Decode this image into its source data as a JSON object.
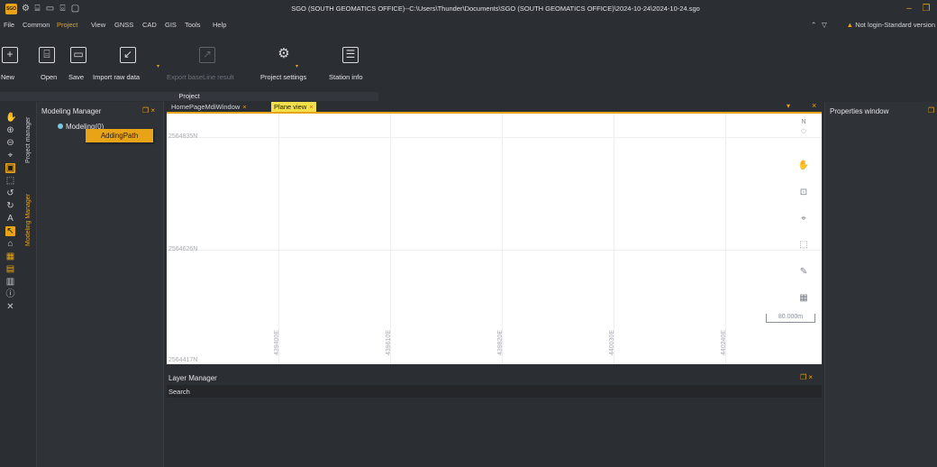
{
  "titlebar": {
    "logo": "SGO",
    "title": "SGO (SOUTH GEOMATICS OFFICE)--C:\\Users\\Thunder\\Documents\\SGO (SOUTH GEOMATICS OFFICE)\\2024-10-24\\2024-10-24.sgo",
    "quick_icons": [
      "settings-icon",
      "open-icon",
      "save-icon",
      "import-icon",
      "export-icon"
    ]
  },
  "menu": {
    "items": [
      "File",
      "Common",
      "Project",
      "View",
      "GNSS",
      "CAD",
      "GIS",
      "Tools",
      "Help"
    ],
    "active": "Project",
    "login": "Not login-Standard version"
  },
  "ribbon": {
    "buttons": [
      {
        "label": "New",
        "icon": "new-project-icon",
        "glyph": "+",
        "enabled": true
      },
      {
        "label": "Open",
        "icon": "open-folder-icon",
        "glyph": "⌸",
        "enabled": true
      },
      {
        "label": "Save",
        "icon": "save-icon",
        "glyph": "▭",
        "enabled": true
      },
      {
        "label": "Import raw data",
        "icon": "import-icon",
        "glyph": "↙",
        "enabled": true
      },
      {
        "label": "Export baseLine result",
        "icon": "export-icon",
        "glyph": "↗",
        "enabled": false
      },
      {
        "label": "Project settings",
        "icon": "gear-icon",
        "glyph": "⚙",
        "enabled": true
      },
      {
        "label": "Station info",
        "icon": "document-icon",
        "glyph": "☰",
        "enabled": true
      }
    ],
    "group_label": "Project"
  },
  "left_tabs": [
    "Project manager",
    "Modeling Manager"
  ],
  "modeling": {
    "title": "Modeling Manager",
    "tree_node": "Modeling(0)",
    "context_menu_item": "AddingPath"
  },
  "tabs": [
    "HomePageMdiWindow",
    "Plane view"
  ],
  "active_tab": "Plane view",
  "plane_view": {
    "northing_labels": [
      "2564835N",
      "2564626N",
      "2564417N"
    ],
    "easting_labels": [
      "439400E",
      "439610E",
      "439820E",
      "440030E",
      "440240E"
    ],
    "scale": "80.000m",
    "tools": [
      "pan-hand-icon",
      "zoom-window-icon",
      "zoom-extents-icon",
      "select-box-icon",
      "measure-icon",
      "grid-icon"
    ]
  },
  "layer_manager": {
    "title": "Layer Manager",
    "search_label": "Search",
    "search_value": ""
  },
  "properties": {
    "title": "Properties window"
  },
  "colors": {
    "accent": "#e8a317",
    "tab_active": "#f2e04a",
    "background": "#2b2e33"
  }
}
